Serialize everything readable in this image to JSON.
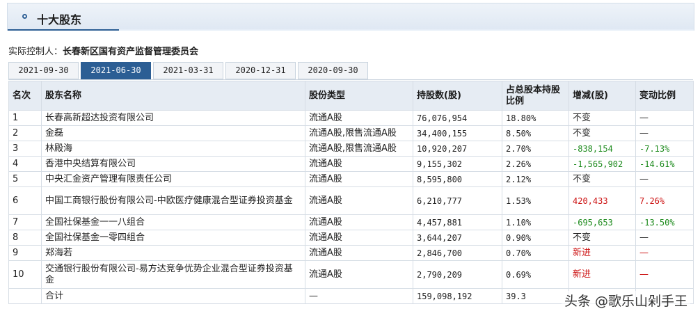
{
  "panel": {
    "title": "十大股东"
  },
  "controller": {
    "label": "实际控制人：",
    "value": "长春新区国有资产监督管理委员会"
  },
  "tabs": [
    {
      "label": "2021-09-30",
      "active": false
    },
    {
      "label": "2021-06-30",
      "active": true
    },
    {
      "label": "2021-03-31",
      "active": false
    },
    {
      "label": "2020-12-31",
      "active": false
    },
    {
      "label": "2020-09-30",
      "active": false
    }
  ],
  "table": {
    "headers": {
      "rank": "名次",
      "name": "股东名称",
      "type": "股份类型",
      "shares": "持股数(股)",
      "ratio": "占总股本持股比例",
      "change": "增减(股)",
      "change_ratio": "变动比例"
    },
    "rows": [
      {
        "rank": "1",
        "name": "长春高新超达投资有限公司",
        "type": "流通A股",
        "shares": "76,076,954",
        "ratio": "18.80%",
        "change": "不变",
        "change_ratio": "—"
      },
      {
        "rank": "2",
        "name": "金磊",
        "type": "流通A股,限售流通A股",
        "shares": "34,400,155",
        "ratio": "8.50%",
        "change": "不变",
        "change_ratio": "—"
      },
      {
        "rank": "3",
        "name": "林殿海",
        "type": "流通A股,限售流通A股",
        "shares": "10,920,207",
        "ratio": "2.70%",
        "change": "-838,154",
        "change_ratio": "-7.13%"
      },
      {
        "rank": "4",
        "name": "香港中央结算有限公司",
        "type": "流通A股",
        "shares": "9,155,302",
        "ratio": "2.26%",
        "change": "-1,565,902",
        "change_ratio": "-14.61%"
      },
      {
        "rank": "5",
        "name": "中央汇金资产管理有限责任公司",
        "type": "流通A股",
        "shares": "8,595,800",
        "ratio": "2.12%",
        "change": "不变",
        "change_ratio": "—"
      },
      {
        "rank": "6",
        "name": "中国工商银行股份有限公司-中欧医疗健康混合型证券投资基金",
        "type": "流通A股",
        "shares": "6,210,777",
        "ratio": "1.53%",
        "change": "420,433",
        "change_ratio": "7.26%"
      },
      {
        "rank": "7",
        "name": "全国社保基金一一八组合",
        "type": "流通A股",
        "shares": "4,457,881",
        "ratio": "1.10%",
        "change": "-695,653",
        "change_ratio": "-13.50%"
      },
      {
        "rank": "8",
        "name": "全国社保基金一零四组合",
        "type": "流通A股",
        "shares": "3,644,207",
        "ratio": "0.90%",
        "change": "不变",
        "change_ratio": "—"
      },
      {
        "rank": "9",
        "name": "郑海若",
        "type": "流通A股",
        "shares": "2,846,700",
        "ratio": "0.70%",
        "change": "新进",
        "change_ratio": "—"
      },
      {
        "rank": "10",
        "name": "交通银行股份有限公司-易方达竞争优势企业混合型证券投资基金",
        "type": "流通A股",
        "shares": "2,790,209",
        "ratio": "0.69%",
        "change": "新进",
        "change_ratio": "—"
      }
    ],
    "total": {
      "label": "合计",
      "type": "—",
      "shares": "159,098,192",
      "ratio": "39.3"
    }
  },
  "watermark": "头条 @歌乐山剁手王",
  "colors": {
    "accent": "#2c5e94",
    "header_bg": "#e6ecf3",
    "decrease": "#1c8a1c",
    "increase": "#cc1010"
  }
}
